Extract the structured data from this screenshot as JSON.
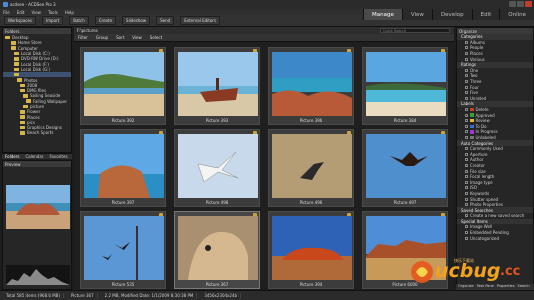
{
  "window": {
    "title": "acdsee - ACDSee Pro 3"
  },
  "menu": [
    "File",
    "Edit",
    "View",
    "Tools",
    "Help"
  ],
  "toolbar": {
    "items": [
      "Workspaces",
      "Import",
      "Batch",
      "Create",
      "Slideshow",
      "Send",
      "External Editors"
    ]
  },
  "modes": [
    "Manage",
    "View",
    "Develop",
    "Edit",
    "Online"
  ],
  "active_mode": "Manage",
  "folders": {
    "title": "Folders",
    "rows": [
      "Desktop",
      "Home Store",
      "Computer",
      "Local Disk (C:)",
      "DVD-RW Drive (D:)",
      "Local Disk (F:)",
      "Local Disk (G:)",
      "",
      "Photos",
      "2008",
      "DMG files",
      "Sailing Seaside",
      "Falling Wallpaper",
      "picture",
      "Flower",
      "Places",
      "pics",
      "Graphics Designs",
      "Beach Sports"
    ]
  },
  "left_tabs": [
    "Folders",
    "Calendar",
    "Favorites"
  ],
  "preview": {
    "title": "Preview"
  },
  "breadcrumb": "F:\\pictures",
  "search_placeholder": "Quick Search",
  "filterbar": [
    "Filter",
    "Group",
    "Sort",
    "View",
    "Select"
  ],
  "thumbs": [
    {
      "caption": "Picture 392",
      "scene": "beach"
    },
    {
      "caption": "Picture 393",
      "scene": "wreck"
    },
    {
      "caption": "Picture 396",
      "scene": "rocks"
    },
    {
      "caption": "Picture 384",
      "scene": "coast"
    },
    {
      "caption": "Picture 397",
      "scene": "cliff"
    },
    {
      "caption": "Picture 498",
      "scene": "bird-white"
    },
    {
      "caption": "Picture 496",
      "scene": "bird-sand"
    },
    {
      "caption": "Picture 497",
      "scene": "bird-sky"
    },
    {
      "caption": "Picture 535",
      "scene": "birds-sky"
    },
    {
      "caption": "Picture 367",
      "scene": "camel"
    },
    {
      "caption": "Picture 394",
      "scene": "uluru"
    },
    {
      "caption": "Picture 6000",
      "scene": "desert"
    }
  ],
  "organize": {
    "title": "Organize",
    "categories_title": "Categories",
    "categories": [
      "Albums",
      "People",
      "Places",
      "Various"
    ],
    "ratings_title": "Ratings",
    "ratings": [
      "One",
      "Two",
      "Three",
      "Four",
      "Five",
      "Unrated"
    ],
    "labels_title": "Labels",
    "labels": [
      {
        "name": "Delete",
        "color": "#d23a2a"
      },
      {
        "name": "Approved",
        "color": "#3aa13a"
      },
      {
        "name": "Review",
        "color": "#e0c030"
      },
      {
        "name": "To Do",
        "color": "#3a6fd2"
      },
      {
        "name": "In Progress",
        "color": "#9b3ad2"
      },
      {
        "name": "Unlabeled",
        "color": "#777777"
      }
    ],
    "auto_title": "Auto Categories",
    "auto": [
      "Commonly Used",
      "Aperture",
      "Author",
      "Creator",
      "File size",
      "Focal length",
      "Image type",
      "ISO",
      "Keywords",
      "Shutter speed",
      "Photo Properties"
    ],
    "saved_title": "Saved Searches",
    "saved": [
      "Create a new saved search"
    ],
    "special_title": "Special Items",
    "special": [
      "Image Well",
      "Embedded Pending",
      "Uncategorized"
    ]
  },
  "right_tabs": [
    "Organize",
    "Task Pane",
    "Properties",
    "Search"
  ],
  "status": [
    "Total 585 items (968.6 MB)",
    "Picture 367",
    "2.2 MB, Modified Date: 1/1/2009 8:30:38 PM",
    "3456x2304x24b"
  ],
  "watermark": {
    "text": "ucbug",
    "domain": ".cc",
    "tagline": "快乐下载站"
  }
}
